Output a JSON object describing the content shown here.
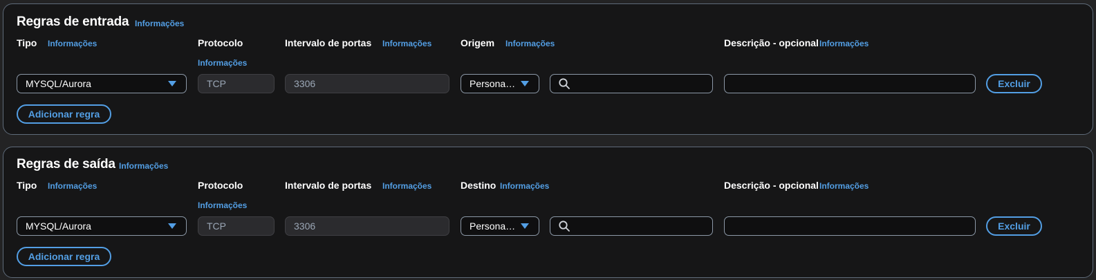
{
  "inbound": {
    "title": "Regras de entrada",
    "title_info": "Informações",
    "columns": {
      "type_label": "Tipo",
      "type_info": "Informações",
      "protocol_label": "Protocolo",
      "protocol_info": "Informações",
      "port_label": "Intervalo de portas",
      "port_info": "Informações",
      "source_label": "Origem",
      "source_info": "Informações",
      "desc_label": "Descrição - opcional",
      "desc_info": "Informações"
    },
    "rule": {
      "type_value": "MYSQL/Aurora",
      "protocol_value": "TCP",
      "port_value": "3306",
      "source_value": "Persona…",
      "search_value": "",
      "desc_value": "",
      "delete_label": "Excluir"
    },
    "add_rule_label": "Adicionar regra"
  },
  "outbound": {
    "title": "Regras de saída",
    "title_info": "Informações",
    "columns": {
      "type_label": "Tipo",
      "type_info": "Informações",
      "protocol_label": "Protocolo",
      "protocol_info": "Informações",
      "port_label": "Intervalo de portas",
      "port_info": "Informações",
      "dest_label": "Destino",
      "dest_info": "Informações",
      "desc_label": "Descrição - opcional",
      "desc_info": "Informações"
    },
    "rule": {
      "type_value": "MYSQL/Aurora",
      "protocol_value": "TCP",
      "port_value": "3306",
      "dest_value": "Persona…",
      "search_value": "",
      "desc_value": "",
      "delete_label": "Excluir"
    },
    "add_rule_label": "Adicionar regra"
  },
  "colors": {
    "accent": "#539fe5",
    "panel_bg": "#161617",
    "page_bg": "#232324",
    "border": "#5f6b7a"
  },
  "icons": {
    "search": "search-icon",
    "dropdown": "chevron-down-icon"
  }
}
